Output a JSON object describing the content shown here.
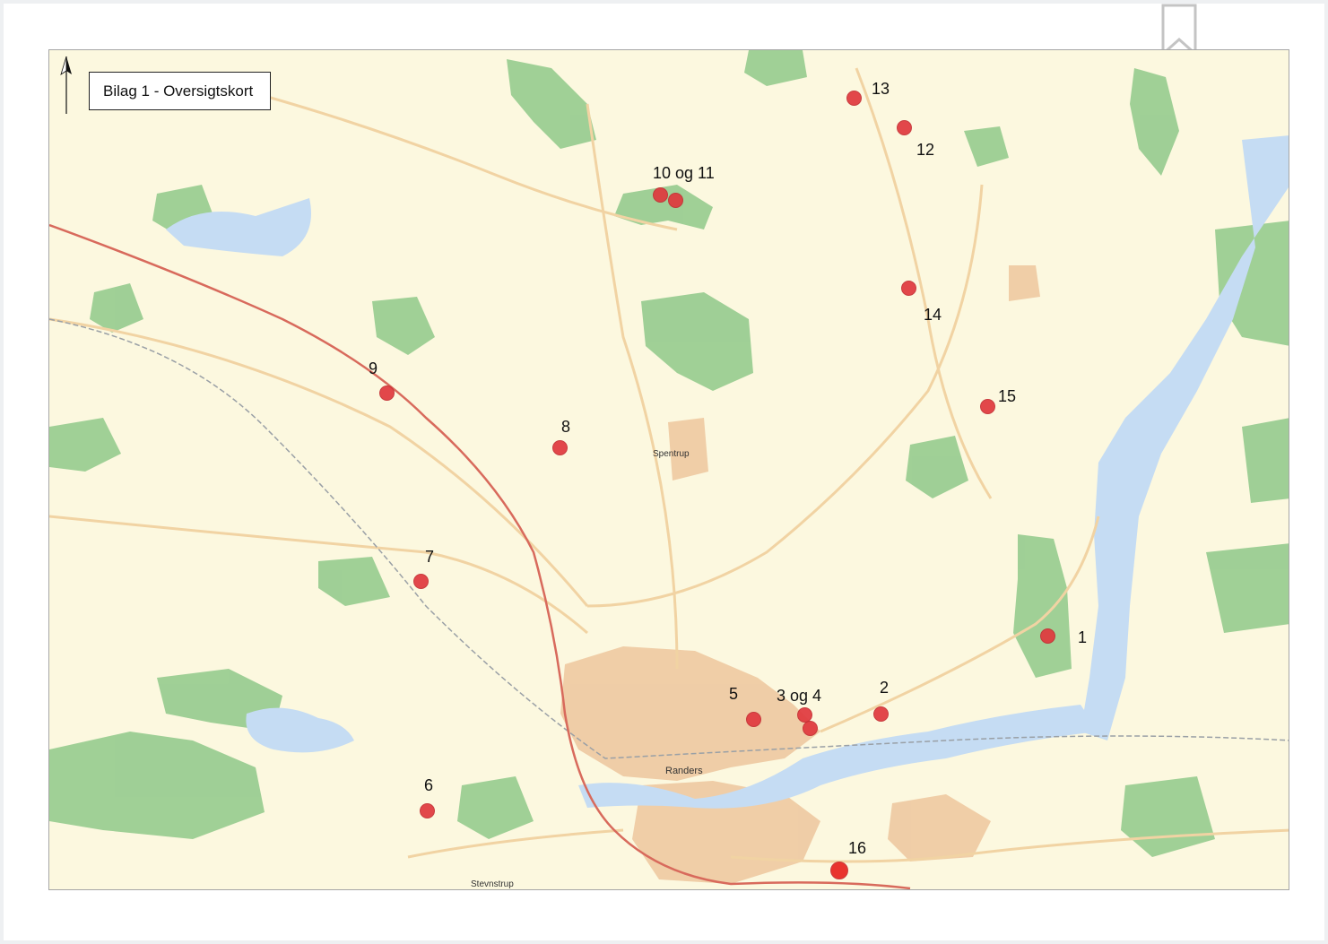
{
  "map": {
    "title": "Bilag 1 - Oversigtskort",
    "colors": {
      "land": "#fcf8df",
      "forest": "#8fc98a",
      "town": "#eec9a1",
      "water": "#c5dcf3",
      "motorway": "#d86a5c",
      "road": "#f1d3a3",
      "marker": "#e0393e"
    },
    "markers": [
      {
        "label": "1",
        "icon": "location-dot-icon"
      },
      {
        "label": "2",
        "icon": "location-dot-icon"
      },
      {
        "label": "3 og 4",
        "icon": "location-dot-icon"
      },
      {
        "label": "5",
        "icon": "location-dot-icon"
      },
      {
        "label": "6",
        "icon": "location-dot-icon"
      },
      {
        "label": "7",
        "icon": "location-dot-icon"
      },
      {
        "label": "8",
        "icon": "location-dot-icon"
      },
      {
        "label": "9",
        "icon": "location-dot-icon"
      },
      {
        "label": "10 og 11",
        "icon": "location-dot-icon"
      },
      {
        "label": "12",
        "icon": "location-dot-icon"
      },
      {
        "label": "13",
        "icon": "location-dot-icon"
      },
      {
        "label": "14",
        "icon": "location-dot-icon"
      },
      {
        "label": "15",
        "icon": "location-dot-icon"
      },
      {
        "label": "16",
        "icon": "location-dot-icon"
      }
    ],
    "places": {
      "randers": "Randers",
      "spentrup": "Spentrup",
      "stevnstrup": "Stevnstrup"
    }
  },
  "icons": {
    "north": "north-arrow-icon",
    "bookmark": "bookmark-icon"
  }
}
